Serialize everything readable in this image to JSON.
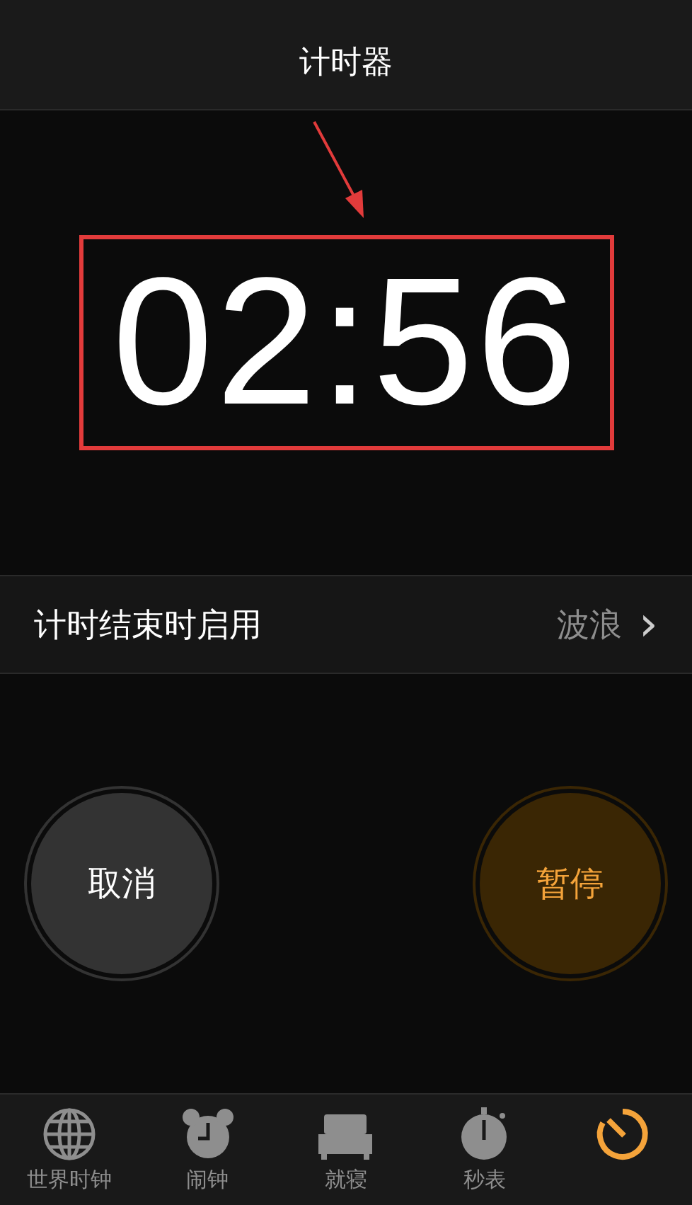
{
  "header": {
    "title": "计时器"
  },
  "timer": {
    "time": "02:56",
    "annotated": true
  },
  "sound_row": {
    "label": "计时结束时启用",
    "value": "波浪",
    "chevron": "›"
  },
  "buttons": [
    {
      "kind": "cancel",
      "label": "取消"
    },
    {
      "kind": "pause",
      "label": "暂停"
    }
  ],
  "tabs": [
    {
      "kind": "globe",
      "label": "世界时钟",
      "selected": false
    },
    {
      "kind": "alarm",
      "label": "闹钟",
      "selected": false
    },
    {
      "kind": "bed",
      "label": "就寝",
      "selected": false
    },
    {
      "kind": "stopwatch",
      "label": "秒表",
      "selected": false
    },
    {
      "kind": "timer",
      "selected": true
    }
  ]
}
